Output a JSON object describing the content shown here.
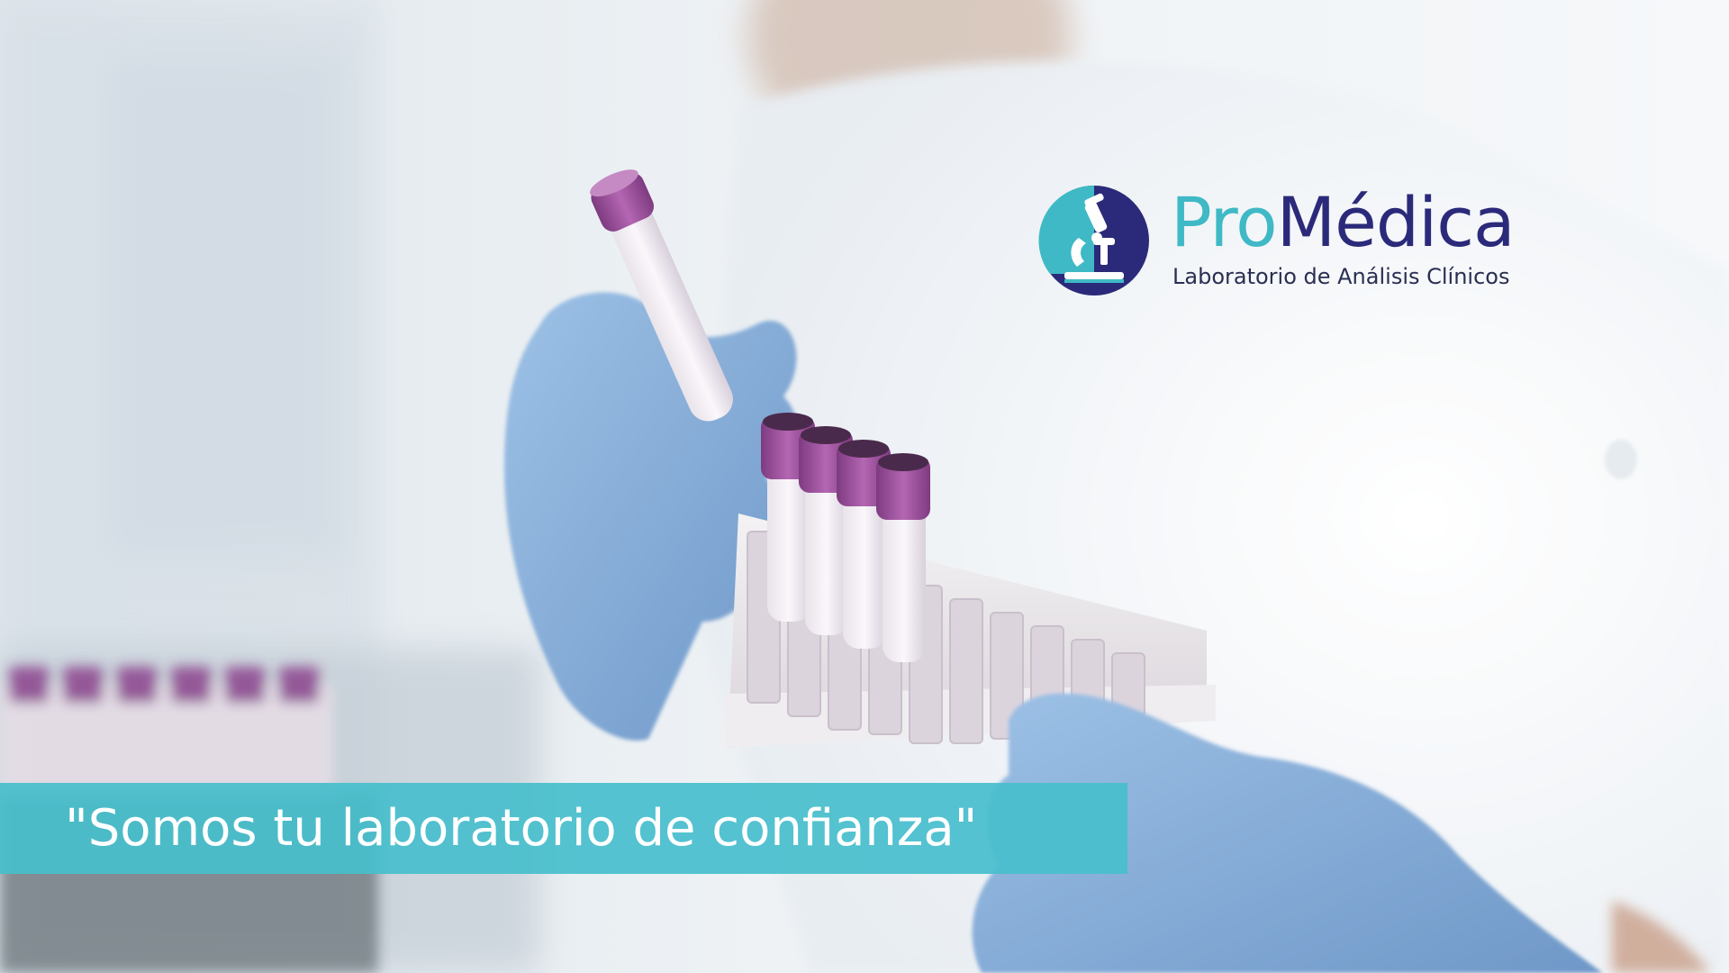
{
  "brand": {
    "name_part1": "Pro",
    "name_part2": "Médica",
    "tagline": "Laboratorio de Análisis Clínicos",
    "logo_icon": "microscope-icon",
    "colors": {
      "teal": "#3fb9c5",
      "navy": "#2b2a7a"
    }
  },
  "banner": {
    "quote": "\"Somos tu laboratorio de confianza\"",
    "color": "#48becc"
  },
  "photo": {
    "colors": {
      "glove": "#8cb2dc",
      "tube_cap": "#9c4f9a",
      "background": "#e9eef2"
    }
  }
}
